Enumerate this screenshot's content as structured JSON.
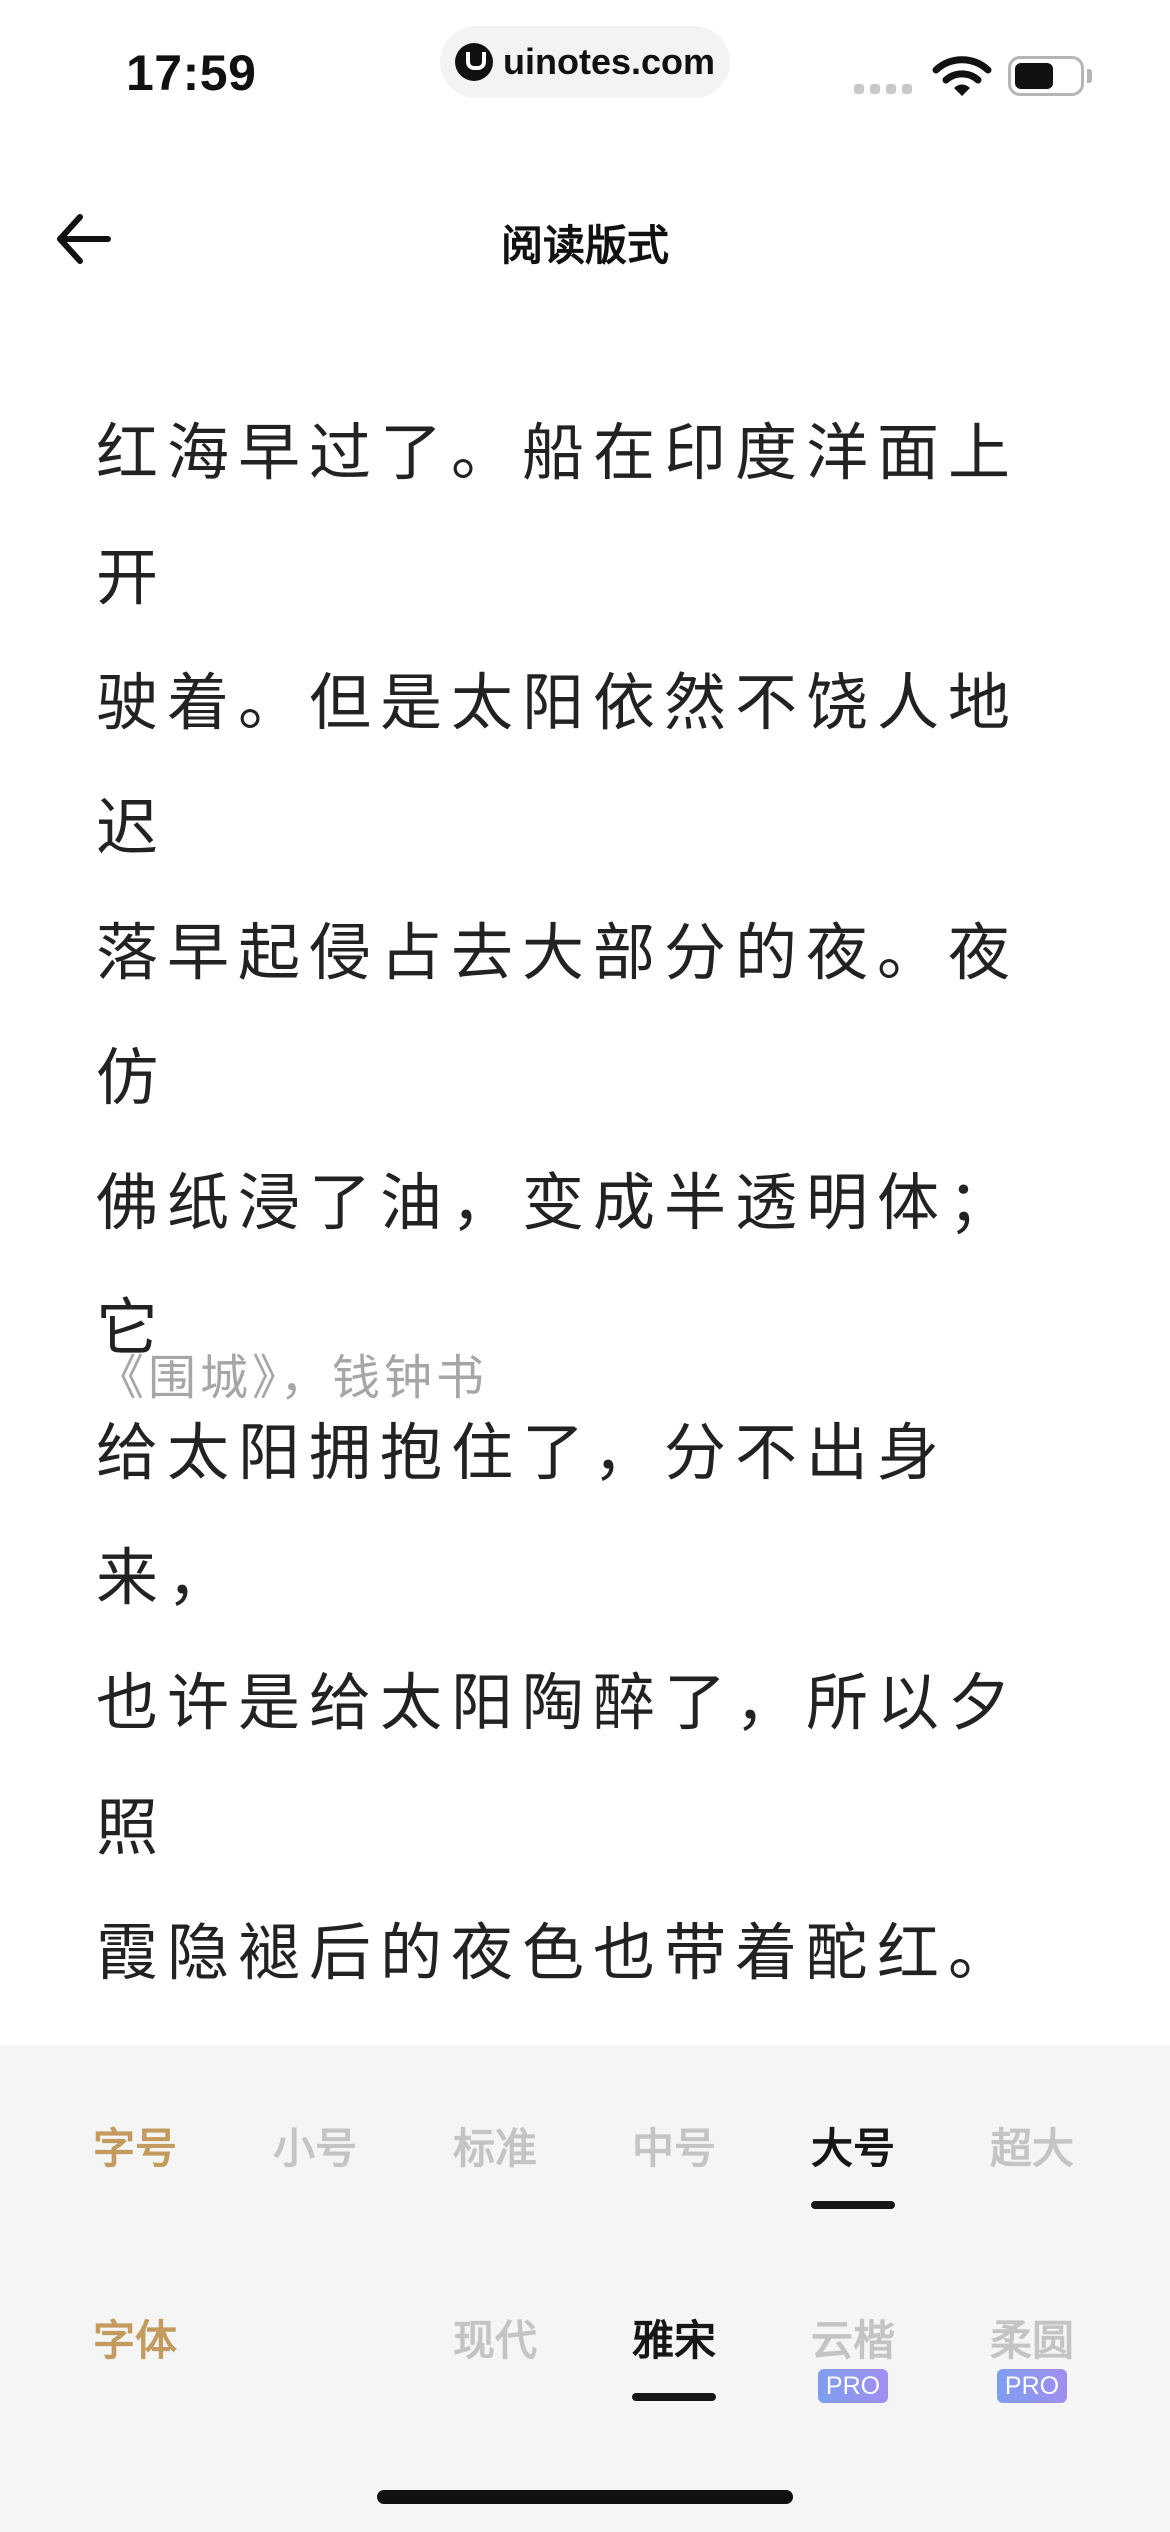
{
  "status_bar": {
    "time": "17:59",
    "url": "uinotes.com",
    "battery_level": 0.6,
    "icons": [
      "url-logo-icon",
      "signal-icon",
      "wifi-icon",
      "battery-icon"
    ]
  },
  "nav": {
    "title": "阅读版式",
    "back_icon": "arrow-left-icon"
  },
  "preview": {
    "lines": [
      "红海早过了。船在印度洋面上开",
      "驶着。但是太阳依然不饶人地迟",
      "落早起侵占去大部分的夜。夜仿",
      "佛纸浸了油，变成半透明体；它",
      "给太阳拥抱住了，分不出身来，",
      "也许是给太阳陶醉了，所以夕照",
      "霞隐褪后的夜色也带着酡红。"
    ],
    "citation": "《围城》，钱钟书"
  },
  "settings": {
    "font_size": {
      "label": "字号",
      "options": [
        "小号",
        "标准",
        "中号",
        "大号",
        "超大"
      ],
      "selected": "大号"
    },
    "font_family": {
      "label": "字体",
      "options": [
        "现代",
        "雅宋",
        "云楷",
        "柔圆"
      ],
      "selected": "雅宋",
      "pro_badge": "PRO"
    }
  },
  "colors": {
    "accent_label": "#c39b5e",
    "selected": "#161616",
    "unselected": "#c4c4c4",
    "panel_bg": "#f5f5f5",
    "pro_gradient": [
      "#7f9ef0",
      "#9f8ef0"
    ]
  }
}
